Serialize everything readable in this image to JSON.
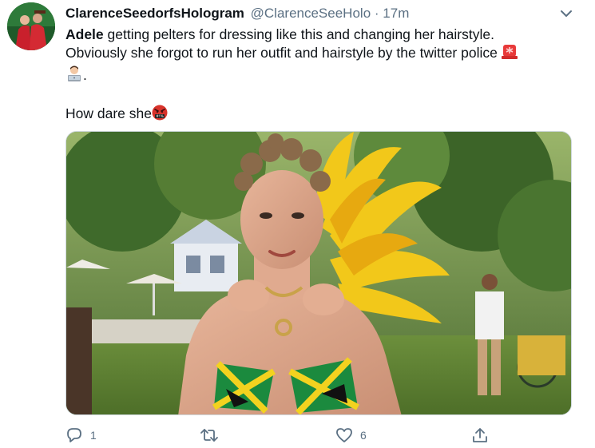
{
  "tweet": {
    "display_name": "ClarenceSeedorfsHologram",
    "handle": "@ClarenceSeeHolo",
    "separator": "·",
    "time": "17m",
    "text_bold": "Adele",
    "text_line1_rest": " getting pelters for dressing like this and changing her hairstyle.",
    "text_line2": "Obviously she forgot to run her outfit and hairstyle by the twitter police",
    "text_line3_tail": ".",
    "text_line4": "How dare she",
    "emojis": [
      "rotating-light-emoji",
      "technologist-emoji",
      "cursing-face-emoji"
    ]
  },
  "actions": {
    "reply_count": "1",
    "retweet_count": "",
    "like_count": "6"
  },
  "colors": {
    "text": "#0f1419",
    "secondary": "#5b7083",
    "border": "#cfd9de"
  }
}
